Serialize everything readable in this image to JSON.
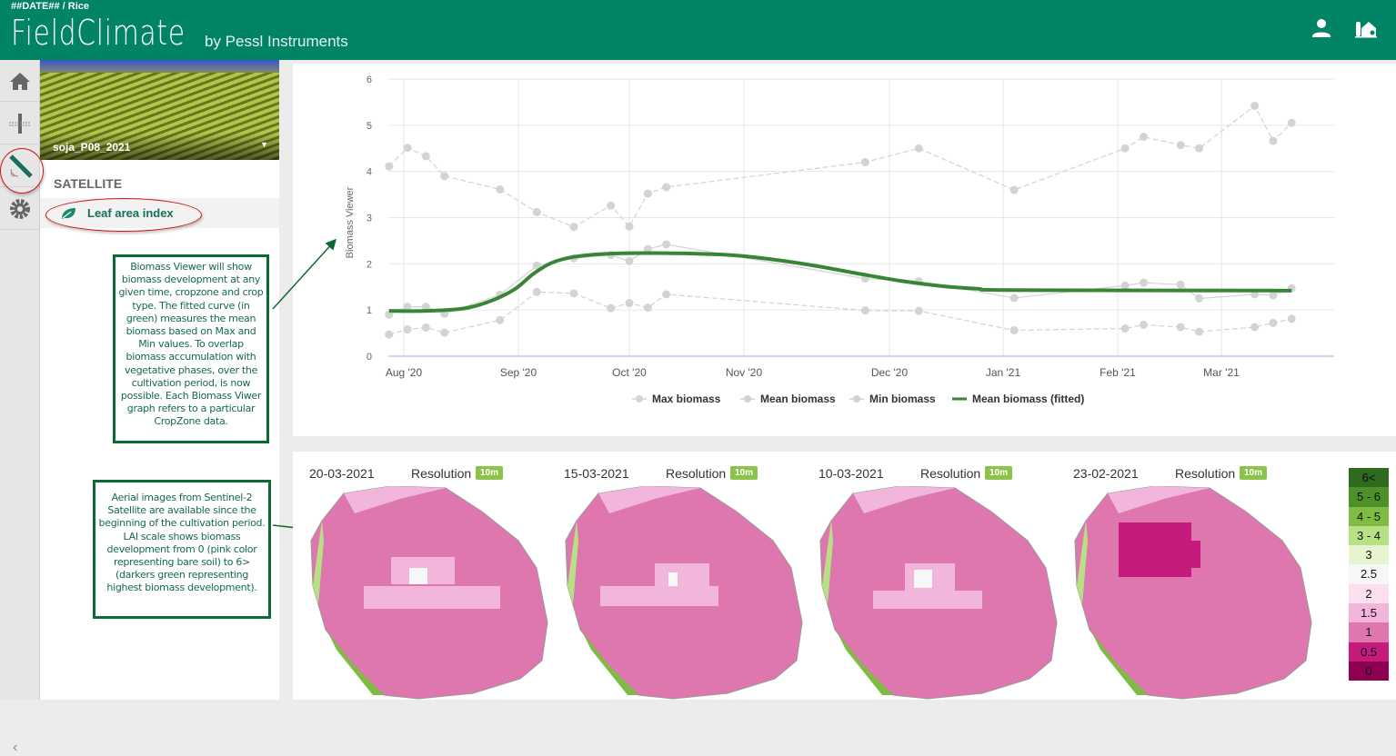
{
  "header": {
    "breadcrumb": "##DATE## / Rice",
    "logo": "FieldClimate",
    "logo_sub": "by Pessl Instruments",
    "icons": [
      "user-icon",
      "farm-icon"
    ]
  },
  "rail": {
    "items": [
      "home-icon",
      "sensor-icon",
      "satellite-icon",
      "gear-icon"
    ],
    "collapse": "‹"
  },
  "panel": {
    "field_name": "soja_P08_2021",
    "section_title": "SATELLITE",
    "menu_item": "Leaf area index"
  },
  "notes": {
    "chart_note": "Biomass Viewer will show biomass development at any given time, cropzone and crop type. The fitted curve (in green) measures the mean biomass based on Max and Min values. To overlap biomass accumulation with vegetative phases, over the cultivation period, is now possible. Each Biomass Viwer graph refers to a particular CropZone data.",
    "map_note": "Aerial images from Sentinel-2 Satellite are available since the beginning of the cultivation period. LAI scale shows biomass development from 0 (pink color representing bare soil) to 6> (darkers green representing highest biomass development)."
  },
  "chart_data": {
    "type": "line",
    "ylabel": "Biomass Viewer",
    "ylim": [
      0,
      6
    ],
    "yticks": [
      "0",
      "1",
      "2",
      "3",
      "4",
      "5",
      "6"
    ],
    "xticks": [
      {
        "date": "2020-08-01",
        "label": "Aug '20"
      },
      {
        "date": "2020-09-01",
        "label": "Sep '20"
      },
      {
        "date": "2020-10-01",
        "label": "Oct '20"
      },
      {
        "date": "2020-11-01",
        "label": "Nov '20"
      },
      {
        "date": "2020-12-01",
        "label": "Dec '20"
      },
      {
        "date": "2021-01-01",
        "label": "Jan '21"
      },
      {
        "date": "2021-02-01",
        "label": "Feb '21"
      },
      {
        "date": "2021-03-01",
        "label": "Mar '21"
      }
    ],
    "grid": true,
    "legend": "bottom",
    "series": [
      {
        "name": "Max biomass",
        "color": "#d3d3d3",
        "dashed": true,
        "markers": true,
        "x": [
          "2020-07-28",
          "2020-08-02",
          "2020-08-07",
          "2020-08-12",
          "2020-08-27",
          "2020-09-06",
          "2020-09-16",
          "2020-09-26",
          "2020-10-01",
          "2020-10-06",
          "2020-10-11",
          "2020-11-26",
          "2020-12-09",
          "2021-01-04",
          "2021-02-03",
          "2021-02-08",
          "2021-02-18",
          "2021-02-23",
          "2021-03-10",
          "2021-03-15",
          "2021-03-20"
        ],
        "y": [
          4.11,
          4.51,
          4.33,
          3.9,
          3.61,
          3.12,
          2.8,
          3.26,
          2.81,
          3.52,
          3.66,
          4.2,
          4.5,
          3.6,
          4.5,
          4.75,
          4.57,
          4.5,
          5.42,
          4.66,
          5.05
        ]
      },
      {
        "name": "Mean biomass",
        "color": "#d3d3d3",
        "dashed": false,
        "markers": true,
        "x": [
          "2020-07-28",
          "2020-08-02",
          "2020-08-07",
          "2020-08-12",
          "2020-08-27",
          "2020-09-06",
          "2020-09-16",
          "2020-09-26",
          "2020-10-01",
          "2020-10-06",
          "2020-10-11",
          "2020-11-26",
          "2020-12-09",
          "2021-01-04",
          "2021-02-03",
          "2021-02-08",
          "2021-02-18",
          "2021-02-23",
          "2021-03-10",
          "2021-03-15",
          "2021-03-20"
        ],
        "y": [
          0.9,
          1.07,
          1.07,
          0.92,
          1.33,
          1.96,
          2.12,
          2.19,
          2.06,
          2.32,
          2.42,
          1.68,
          1.62,
          1.26,
          1.53,
          1.59,
          1.55,
          1.25,
          1.34,
          1.32,
          1.47
        ]
      },
      {
        "name": "Min biomass",
        "color": "#d3d3d3",
        "dashed": true,
        "markers": true,
        "x": [
          "2020-07-28",
          "2020-08-02",
          "2020-08-07",
          "2020-08-12",
          "2020-08-27",
          "2020-09-06",
          "2020-09-16",
          "2020-09-26",
          "2020-10-01",
          "2020-10-06",
          "2020-10-11",
          "2020-11-26",
          "2020-12-09",
          "2021-01-04",
          "2021-02-03",
          "2021-02-08",
          "2021-02-18",
          "2021-02-23",
          "2021-03-10",
          "2021-03-15",
          "2021-03-20"
        ],
        "y": [
          0.47,
          0.58,
          0.62,
          0.51,
          0.78,
          1.39,
          1.36,
          1.04,
          1.15,
          1.05,
          1.34,
          0.99,
          0.98,
          0.56,
          0.6,
          0.68,
          0.63,
          0.53,
          0.63,
          0.72,
          0.81
        ]
      },
      {
        "name": "Mean biomass (fitted)",
        "color": "#3a8535",
        "dashed": false,
        "markers": false,
        "x": [
          "2020-07-28",
          "2020-08-07",
          "2020-08-17",
          "2020-08-24",
          "2020-08-31",
          "2020-09-05",
          "2020-09-10",
          "2020-09-16",
          "2020-09-26",
          "2020-10-11",
          "2020-10-26",
          "2020-11-05",
          "2020-11-15",
          "2020-11-25",
          "2020-12-05",
          "2020-12-15",
          "2020-12-25",
          "2021-01-04",
          "2021-03-20"
        ],
        "y": [
          0.98,
          0.98,
          1.03,
          1.18,
          1.45,
          1.78,
          2.02,
          2.15,
          2.22,
          2.23,
          2.2,
          2.12,
          1.97,
          1.78,
          1.62,
          1.52,
          1.46,
          1.43,
          1.42
        ]
      }
    ]
  },
  "maps": [
    {
      "date": "20-03-2021",
      "resolution_label": "Resolution",
      "resolution": "10m"
    },
    {
      "date": "15-03-2021",
      "resolution_label": "Resolution",
      "resolution": "10m"
    },
    {
      "date": "10-03-2021",
      "resolution_label": "Resolution",
      "resolution": "10m"
    },
    {
      "date": "23-02-2021",
      "resolution_label": "Resolution",
      "resolution": "10m"
    }
  ],
  "lai_scale": [
    {
      "label": "6<",
      "color": "#2e6b1e"
    },
    {
      "label": "5 - 6",
      "color": "#4d9228"
    },
    {
      "label": "4 - 5",
      "color": "#7fbc41"
    },
    {
      "label": "3 - 4",
      "color": "#b8e186"
    },
    {
      "label": "3",
      "color": "#e6f5d0"
    },
    {
      "label": "2.5",
      "color": "#f7f7f7"
    },
    {
      "label": "2",
      "color": "#fde0ef"
    },
    {
      "label": "1.5",
      "color": "#f1b6da"
    },
    {
      "label": "1",
      "color": "#de77ae"
    },
    {
      "label": "0.5",
      "color": "#c51b7d"
    },
    {
      "label": "0",
      "color": "#8e0152"
    }
  ]
}
